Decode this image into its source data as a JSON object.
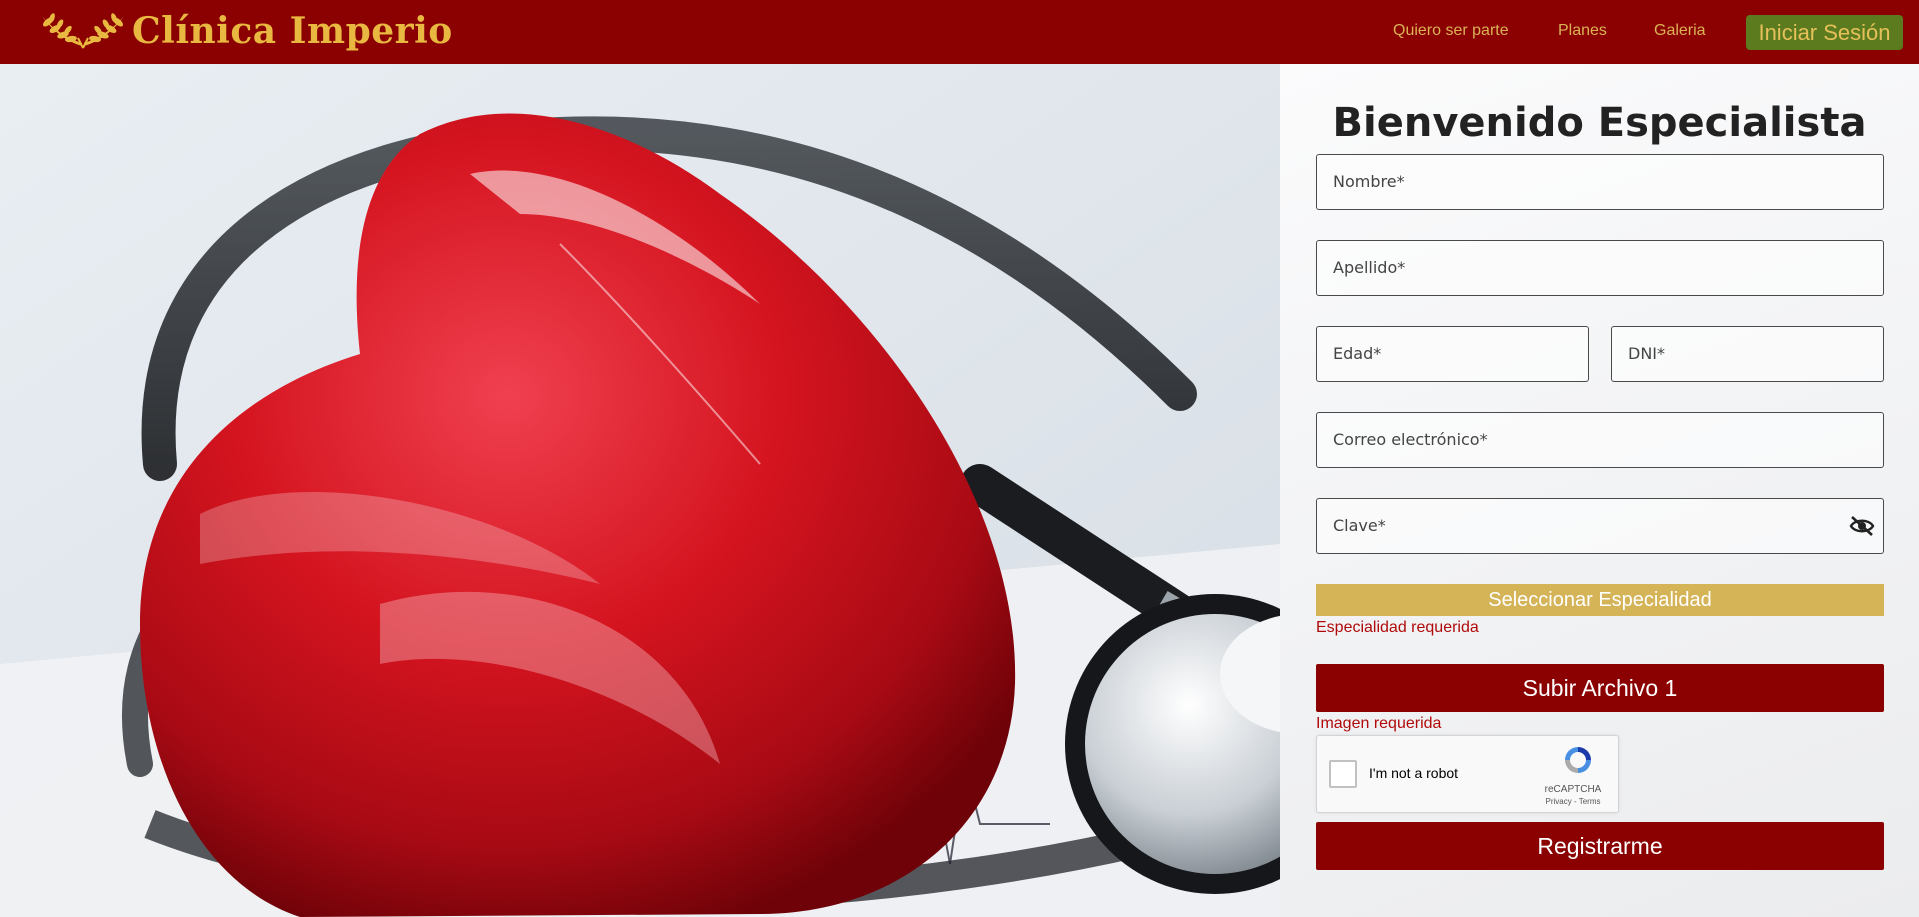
{
  "brand": {
    "name": "Clínica Imperio"
  },
  "nav": {
    "links": [
      "Quiero ser parte",
      "Planes",
      "Galeria"
    ],
    "login_label": "Iniciar Sesión"
  },
  "form": {
    "title": "Bienvenido Especialista",
    "fields": {
      "nombre": "Nombre*",
      "apellido": "Apellido*",
      "edad": "Edad*",
      "dni": "DNI*",
      "correo": "Correo electrónico*",
      "clave": "Clave*"
    },
    "specialty_button": "Seleccionar Especialidad",
    "specialty_error": "Especialidad requerida",
    "upload_button": "Subir Archivo 1",
    "upload_error": "Imagen requerida",
    "captcha": {
      "label": "I'm not a robot",
      "brand": "reCAPTCHA",
      "links": "Privacy - Terms"
    },
    "submit_button": "Registrarme"
  },
  "colors": {
    "navbar": "#8b0000",
    "gold": "#dbb356",
    "login_bg": "#5b7b1e",
    "specialty": "#d4b457",
    "primary": "#8b0000",
    "error": "#b00a0a"
  },
  "icons": {
    "brand": "laurel-wreath-icon",
    "password_toggle": "eye-off-icon",
    "captcha": "recaptcha-logo-icon"
  }
}
